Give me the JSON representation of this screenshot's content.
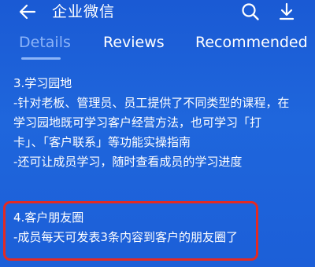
{
  "header": {
    "back_icon": "back-arrow-icon",
    "title": "企业微信",
    "search_icon": "search-icon",
    "download_icon": "download-icon"
  },
  "tabs": [
    {
      "label": "Details",
      "active": true
    },
    {
      "label": "Reviews",
      "active": false
    },
    {
      "label": "Recommended",
      "active": false
    }
  ],
  "content": {
    "section3": {
      "heading": "3.学习园地",
      "lines": [
        "-针对老板、管理员、员工提供了不同类型的课程，在",
        "学习园地既可学习客户经营方法，也可学习「打",
        "卡」、「客户联系」等功能实操指南",
        "-还可让成员学习，随时查看成员的学习进度"
      ]
    },
    "section4": {
      "heading": "4.客户朋友圈",
      "lines": [
        "-成员每天可发表3条内容到客户的朋友圈了"
      ]
    }
  },
  "colors": {
    "background": "#1e62d8",
    "active_tab": "#8cb4f8",
    "highlight_border": "#e32a23",
    "text": "#ffffff"
  }
}
